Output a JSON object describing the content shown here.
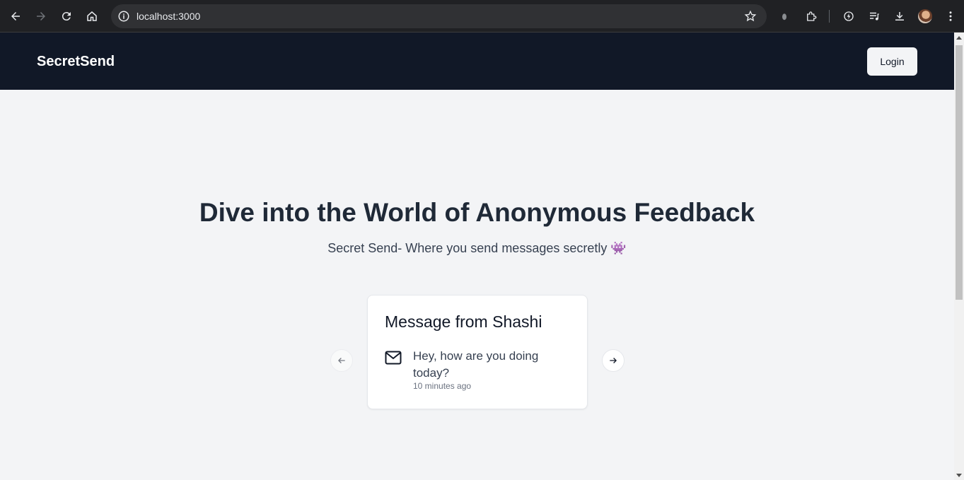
{
  "browser": {
    "url": "localhost:3000"
  },
  "header": {
    "brand": "SecretSend",
    "login_label": "Login"
  },
  "hero": {
    "title": "Dive into the World of Anonymous Feedback",
    "subtitle": "Secret Send- Where you send messages secretly 👾"
  },
  "carousel": {
    "messages": [
      {
        "title": "Message from Shashi",
        "content": "Hey, how are you doing today?",
        "received": "10 minutes ago"
      }
    ]
  },
  "colors": {
    "header_bg": "#111827",
    "page_bg": "#f3f4f6",
    "title_text": "#1f2937"
  }
}
